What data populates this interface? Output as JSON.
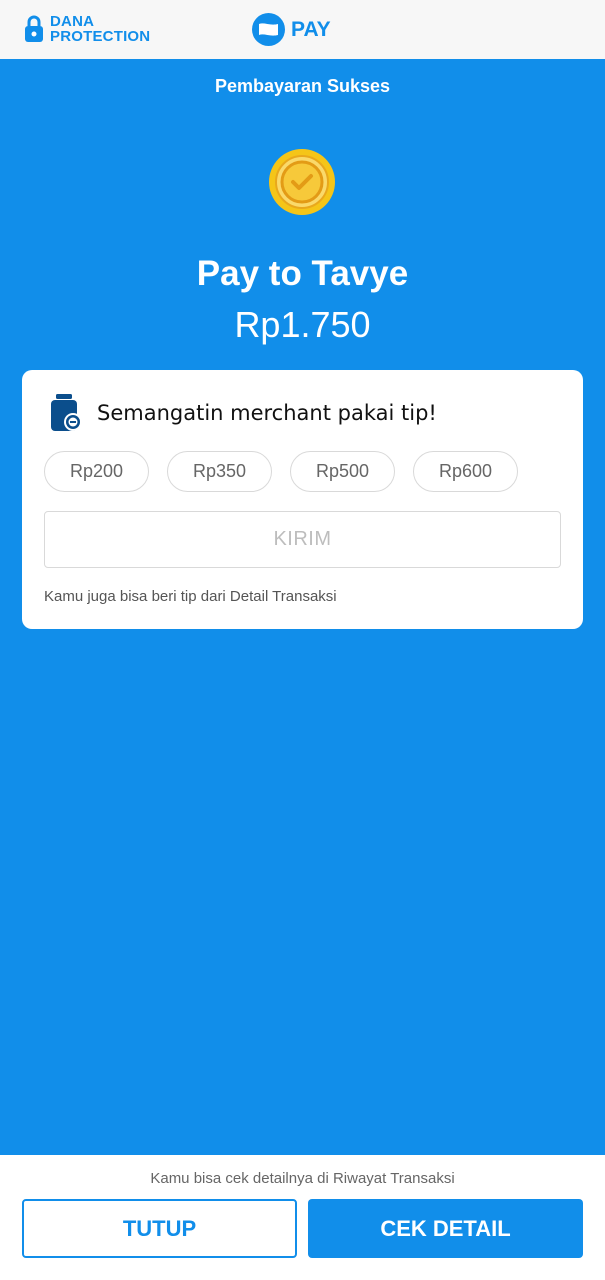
{
  "top_bar": {
    "protection_line1": "DANA",
    "protection_line2": "PROTECTION",
    "pay_label": "PAY"
  },
  "header": {
    "title": "Pembayaran Sukses"
  },
  "payment": {
    "payee": "Pay to Tavye",
    "amount": "Rp1.750"
  },
  "tip_card": {
    "title": "Semangatin merchant pakai tip!",
    "options": [
      "Rp200",
      "Rp350",
      "Rp500",
      "Rp600"
    ],
    "send_label": "KIRIM",
    "note": "Kamu juga bisa beri tip dari Detail Transaksi"
  },
  "bottom": {
    "note": "Kamu bisa cek detailnya di Riwayat Transaksi",
    "close_label": "TUTUP",
    "detail_label": "CEK DETAIL"
  },
  "icons": {
    "lock": "lock-icon",
    "dana": "dana-logo-icon",
    "success": "success-coin-check-icon",
    "tip": "tip-jar-icon"
  },
  "colors": {
    "primary": "#118EEA",
    "top_bar_bg": "#F7F7F7",
    "card_bg": "#FFFFFF",
    "coin_gold": "#F5C518",
    "disabled_text": "#BDBDBD"
  }
}
